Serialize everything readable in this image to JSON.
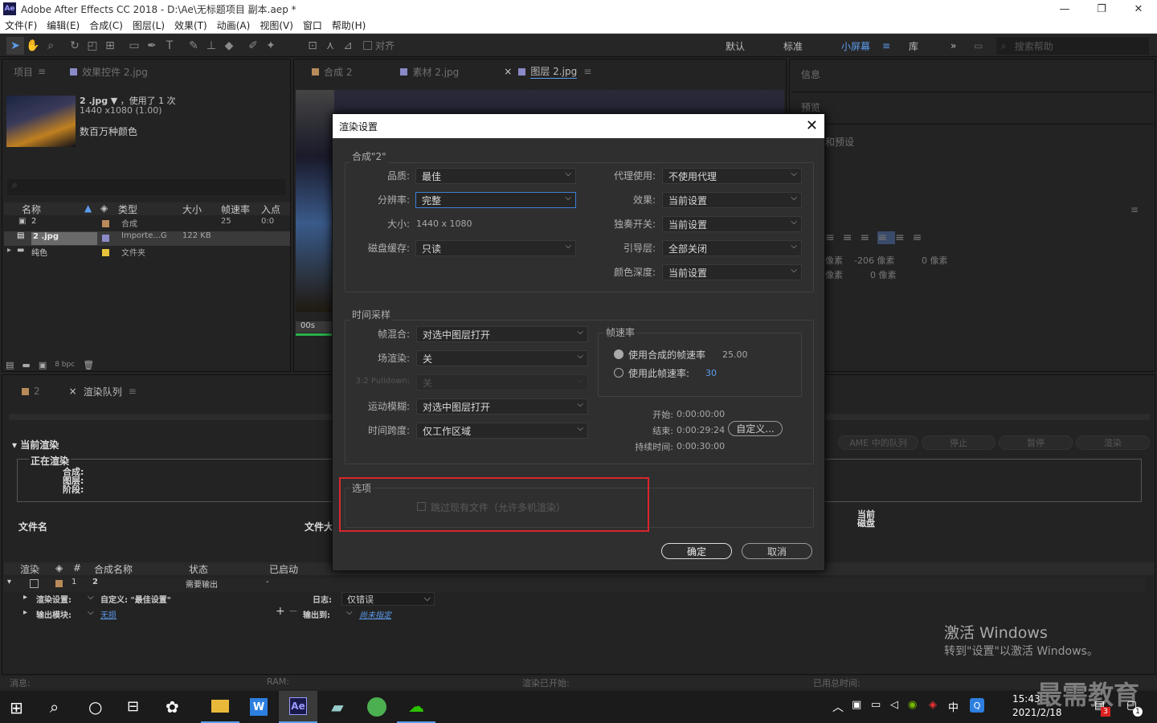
{
  "window": {
    "title": "Adobe After Effects CC 2018 - D:\\Ae\\无标题项目 副本.aep *",
    "logo": "Ae",
    "min": "—",
    "max": "❐",
    "close": "✕"
  },
  "menu": [
    "文件(F)",
    "编辑(E)",
    "合成(C)",
    "图层(L)",
    "效果(T)",
    "动画(A)",
    "视图(V)",
    "窗口",
    "帮助(H)"
  ],
  "toolbar": {
    "align_label": "对齐",
    "workspaces": [
      "默认",
      "标准",
      "小屏幕",
      "库"
    ],
    "more": "»",
    "search_placeholder": "搜索帮助"
  },
  "project": {
    "tabs": [
      "项目",
      "效果控件 2.jpg"
    ],
    "thumb_name": "2 .jpg",
    "thumb_used": "，使用了 1 次",
    "thumb_size": "1440 x1080 (1.00)",
    "thumb_color": "数百万种颜色",
    "columns": [
      "名称",
      "类型",
      "大小",
      "帧速率",
      "入点"
    ],
    "rows": [
      {
        "name": "2",
        "type": "合成",
        "size": "",
        "fps": "25",
        "in": "0:0",
        "color": "#b88a5a"
      },
      {
        "name": "2 .jpg",
        "type": "Importe...G",
        "size": "122 KB",
        "fps": "",
        "in": "",
        "color": "#8a8ac8"
      },
      {
        "name": "纯色",
        "type": "文件夹",
        "size": "",
        "fps": "",
        "in": "",
        "color": "#e8c23a"
      }
    ],
    "bpc": "8 bpc"
  },
  "viewer": {
    "tabs": [
      "合成 2",
      "素材 2.jpg",
      "图层 2.jpg"
    ],
    "time": "00s"
  },
  "right_panel": {
    "info": "信息",
    "preview": "预览",
    "preset": "和预设",
    "lbl1": "像素",
    "lbl2": "-206 像素",
    "lbl3": "0 像素",
    "lbl4": "像素",
    "lbl5": "0 像素"
  },
  "render_queue": {
    "tabs": [
      "2",
      "渲染队列"
    ],
    "current_render": "当前渲染",
    "rendering": "正在渲染",
    "comp": "合成:",
    "layer": "图层:",
    "stage": "阶段:",
    "filename": "文件名",
    "filesize": "文件大",
    "current": "当前",
    "current2": "磁盘",
    "buttons": [
      "AME 中的队列",
      "停止",
      "暂停",
      "渲染"
    ],
    "columns": [
      "渲染",
      "#",
      "合成名称",
      "状态",
      "已启动"
    ],
    "item_num": "1",
    "item_name": "2",
    "item_status": "需要输出",
    "item_started": "-",
    "render_settings_label": "渲染设置:",
    "render_settings_value": "自定义: \"最佳设置\"",
    "log_label": "日志:",
    "log_value": "仅错误",
    "output_module_label": "输出模块:",
    "output_module_value": "无损",
    "output_to_label": "输出到:",
    "output_to_value": "尚未指定",
    "status": {
      "msg": "消息:",
      "ram": "RAM:",
      "started": "渲染已开始:",
      "total": "已用总时间:"
    }
  },
  "dialog": {
    "title": "渲染设置",
    "comp_group": "合成\"2\"",
    "quality_label": "品质:",
    "quality": "最佳",
    "resolution_label": "分辨率:",
    "resolution": "完整",
    "size_label": "大小:",
    "size": "1440 x 1080",
    "disk_cache_label": "磁盘缓存:",
    "disk_cache": "只读",
    "proxy_label": "代理使用:",
    "proxy": "不使用代理",
    "effects_label": "效果:",
    "effects": "当前设置",
    "solo_label": "独奏开关:",
    "solo": "当前设置",
    "guide_label": "引导层:",
    "guide": "全部关闭",
    "depth_label": "颜色深度:",
    "depth": "当前设置",
    "time_group": "时间采样",
    "frame_blend_label": "帧混合:",
    "frame_blend": "对选中图层打开",
    "field_label": "场渲染:",
    "field": "关",
    "pulldown_label": "3:2 Pulldown:",
    "pulldown": "关",
    "motion_blur_label": "运动模糊:",
    "motion_blur": "对选中图层打开",
    "time_span_label": "时间跨度:",
    "time_span": "仅工作区域",
    "fps_group": "帧速率",
    "use_comp_fps": "使用合成的帧速率",
    "comp_fps": "25.00",
    "use_this_fps": "使用此帧速率:",
    "this_fps": "30",
    "start_label": "开始:",
    "start": "0:00:00:00",
    "end_label": "结束:",
    "end": "0:00:29:24",
    "custom_button": "自定义...",
    "duration_label": "持续时间:",
    "duration": "0:00:30:00",
    "options_group": "选项",
    "skip_existing": "跳过现有文件（允许多机渲染）",
    "ok": "确定",
    "cancel": "取消",
    "highlight_color": "#d9262c"
  },
  "watermark": {
    "line1": "激活 Windows",
    "line2": "转到\"设置\"以激活 Windows。",
    "brand": "最需教育"
  },
  "taskbar": {
    "time": "15:43",
    "date": "2021/2/18",
    "ime": "中",
    "notif": "3",
    "badge": "1"
  }
}
